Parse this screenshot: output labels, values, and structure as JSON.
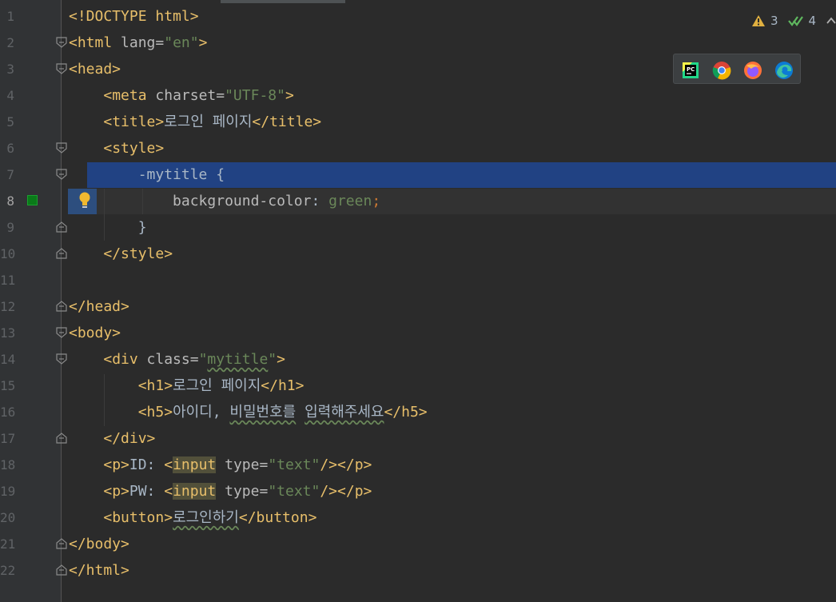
{
  "editor": {
    "lines": [
      {
        "n": "1",
        "segs": [
          {
            "t": "<!DOCTYPE html>",
            "c": "tag"
          }
        ]
      },
      {
        "n": "2",
        "segs": [
          {
            "t": "<",
            "c": "tag"
          },
          {
            "t": "html ",
            "c": "tag"
          },
          {
            "t": "lang",
            "c": "attr"
          },
          {
            "t": "=",
            "c": "attr"
          },
          {
            "t": "\"en\"",
            "c": "str"
          },
          {
            "t": ">",
            "c": "tag"
          }
        ]
      },
      {
        "n": "3",
        "segs": [
          {
            "t": "<head>",
            "c": "tag"
          }
        ]
      },
      {
        "n": "4",
        "segs": [
          {
            "t": "    ",
            "c": ""
          },
          {
            "t": "<meta ",
            "c": "tag"
          },
          {
            "t": "charset",
            "c": "attr"
          },
          {
            "t": "=",
            "c": "attr"
          },
          {
            "t": "\"UTF-8\"",
            "c": "str"
          },
          {
            "t": ">",
            "c": "tag"
          }
        ]
      },
      {
        "n": "5",
        "segs": [
          {
            "t": "    ",
            "c": ""
          },
          {
            "t": "<title>",
            "c": "tag"
          },
          {
            "t": "로그인 페이지",
            "c": ""
          },
          {
            "t": "</title>",
            "c": "tag"
          }
        ]
      },
      {
        "n": "6",
        "segs": [
          {
            "t": "    ",
            "c": ""
          },
          {
            "t": "<style>",
            "c": "tag"
          }
        ]
      },
      {
        "n": "7",
        "segs": [
          {
            "t": "        -mytitle {",
            "c": ""
          }
        ]
      },
      {
        "n": "8",
        "segs": [
          {
            "t": "            ",
            "c": ""
          },
          {
            "t": "background-color",
            "c": "prop"
          },
          {
            "t": ": ",
            "c": ""
          },
          {
            "t": "green",
            "c": "str"
          },
          {
            "t": ";",
            "c": "kw"
          }
        ]
      },
      {
        "n": "9",
        "segs": [
          {
            "t": "        }",
            "c": ""
          }
        ]
      },
      {
        "n": "10",
        "segs": [
          {
            "t": "    ",
            "c": ""
          },
          {
            "t": "</style>",
            "c": "tag"
          }
        ]
      },
      {
        "n": "11",
        "segs": []
      },
      {
        "n": "12",
        "segs": [
          {
            "t": "</head>",
            "c": "tag"
          }
        ]
      },
      {
        "n": "13",
        "segs": [
          {
            "t": "<body>",
            "c": "tag"
          }
        ]
      },
      {
        "n": "14",
        "segs": [
          {
            "t": "    ",
            "c": ""
          },
          {
            "t": "<div ",
            "c": "tag"
          },
          {
            "t": "class",
            "c": "attr"
          },
          {
            "t": "=",
            "c": "attr"
          },
          {
            "t": "\"",
            "c": "str"
          },
          {
            "t": "mytitle",
            "c": "str wavy"
          },
          {
            "t": "\"",
            "c": "str"
          },
          {
            "t": ">",
            "c": "tag"
          }
        ]
      },
      {
        "n": "15",
        "segs": [
          {
            "t": "        ",
            "c": ""
          },
          {
            "t": "<h1>",
            "c": "tag"
          },
          {
            "t": "로그인 페이지",
            "c": ""
          },
          {
            "t": "</h1>",
            "c": "tag"
          }
        ]
      },
      {
        "n": "16",
        "segs": [
          {
            "t": "        ",
            "c": ""
          },
          {
            "t": "<h5>",
            "c": "tag"
          },
          {
            "t": "아이디, ",
            "c": ""
          },
          {
            "t": "비밀번호를",
            "c": "wavy"
          },
          {
            "t": " ",
            "c": ""
          },
          {
            "t": "입력해주세요",
            "c": "wavy"
          },
          {
            "t": "</h5>",
            "c": "tag"
          }
        ]
      },
      {
        "n": "17",
        "segs": [
          {
            "t": "    ",
            "c": ""
          },
          {
            "t": "</div>",
            "c": "tag"
          }
        ]
      },
      {
        "n": "18",
        "segs": [
          {
            "t": "    ",
            "c": ""
          },
          {
            "t": "<p>",
            "c": "tag"
          },
          {
            "t": "ID: ",
            "c": ""
          },
          {
            "t": "<",
            "c": "tag"
          },
          {
            "t": "input",
            "c": "tag hl-input"
          },
          {
            "t": " ",
            "c": ""
          },
          {
            "t": "type",
            "c": "attr"
          },
          {
            "t": "=",
            "c": "attr"
          },
          {
            "t": "\"text\"",
            "c": "str"
          },
          {
            "t": "/></p>",
            "c": "tag"
          }
        ]
      },
      {
        "n": "19",
        "segs": [
          {
            "t": "    ",
            "c": ""
          },
          {
            "t": "<p>",
            "c": "tag"
          },
          {
            "t": "PW: ",
            "c": ""
          },
          {
            "t": "<",
            "c": "tag"
          },
          {
            "t": "input",
            "c": "tag hl-input"
          },
          {
            "t": " ",
            "c": ""
          },
          {
            "t": "type",
            "c": "attr"
          },
          {
            "t": "=",
            "c": "attr"
          },
          {
            "t": "\"text\"",
            "c": "str"
          },
          {
            "t": "/></p>",
            "c": "tag"
          }
        ]
      },
      {
        "n": "20",
        "segs": [
          {
            "t": "    ",
            "c": ""
          },
          {
            "t": "<button>",
            "c": "tag"
          },
          {
            "t": "로그인하기",
            "c": "wavy"
          },
          {
            "t": "</button>",
            "c": "tag"
          }
        ]
      },
      {
        "n": "21",
        "segs": [
          {
            "t": "</body>",
            "c": "tag"
          }
        ]
      },
      {
        "n": "22",
        "segs": [
          {
            "t": "</html>",
            "c": "tag"
          }
        ]
      }
    ]
  },
  "status": {
    "warnings": "3",
    "checks": "4"
  },
  "browsers": [
    {
      "name": "pycharm-icon"
    },
    {
      "name": "chrome-icon"
    },
    {
      "name": "firefox-icon"
    },
    {
      "name": "edge-icon"
    }
  ],
  "colors": {
    "background": "#2b2b2b",
    "gutter": "#313335",
    "selection": "#214283",
    "tag": "#e8bf6a",
    "string": "#6a8759",
    "text": "#a9b7c6"
  }
}
